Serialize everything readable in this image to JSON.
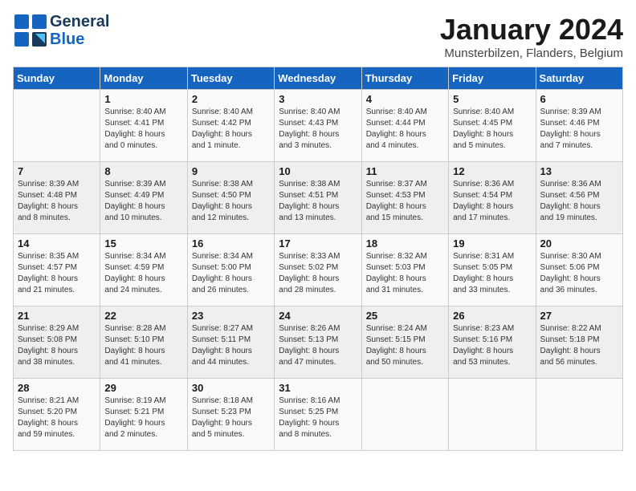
{
  "header": {
    "logo_line1": "General",
    "logo_line2": "Blue",
    "title": "January 2024",
    "subtitle": "Munsterbilzen, Flanders, Belgium"
  },
  "days_of_week": [
    "Sunday",
    "Monday",
    "Tuesday",
    "Wednesday",
    "Thursday",
    "Friday",
    "Saturday"
  ],
  "weeks": [
    [
      {
        "day": "",
        "info": ""
      },
      {
        "day": "1",
        "info": "Sunrise: 8:40 AM\nSunset: 4:41 PM\nDaylight: 8 hours\nand 0 minutes."
      },
      {
        "day": "2",
        "info": "Sunrise: 8:40 AM\nSunset: 4:42 PM\nDaylight: 8 hours\nand 1 minute."
      },
      {
        "day": "3",
        "info": "Sunrise: 8:40 AM\nSunset: 4:43 PM\nDaylight: 8 hours\nand 3 minutes."
      },
      {
        "day": "4",
        "info": "Sunrise: 8:40 AM\nSunset: 4:44 PM\nDaylight: 8 hours\nand 4 minutes."
      },
      {
        "day": "5",
        "info": "Sunrise: 8:40 AM\nSunset: 4:45 PM\nDaylight: 8 hours\nand 5 minutes."
      },
      {
        "day": "6",
        "info": "Sunrise: 8:39 AM\nSunset: 4:46 PM\nDaylight: 8 hours\nand 7 minutes."
      }
    ],
    [
      {
        "day": "7",
        "info": "Sunrise: 8:39 AM\nSunset: 4:48 PM\nDaylight: 8 hours\nand 8 minutes."
      },
      {
        "day": "8",
        "info": "Sunrise: 8:39 AM\nSunset: 4:49 PM\nDaylight: 8 hours\nand 10 minutes."
      },
      {
        "day": "9",
        "info": "Sunrise: 8:38 AM\nSunset: 4:50 PM\nDaylight: 8 hours\nand 12 minutes."
      },
      {
        "day": "10",
        "info": "Sunrise: 8:38 AM\nSunset: 4:51 PM\nDaylight: 8 hours\nand 13 minutes."
      },
      {
        "day": "11",
        "info": "Sunrise: 8:37 AM\nSunset: 4:53 PM\nDaylight: 8 hours\nand 15 minutes."
      },
      {
        "day": "12",
        "info": "Sunrise: 8:36 AM\nSunset: 4:54 PM\nDaylight: 8 hours\nand 17 minutes."
      },
      {
        "day": "13",
        "info": "Sunrise: 8:36 AM\nSunset: 4:56 PM\nDaylight: 8 hours\nand 19 minutes."
      }
    ],
    [
      {
        "day": "14",
        "info": "Sunrise: 8:35 AM\nSunset: 4:57 PM\nDaylight: 8 hours\nand 21 minutes."
      },
      {
        "day": "15",
        "info": "Sunrise: 8:34 AM\nSunset: 4:59 PM\nDaylight: 8 hours\nand 24 minutes."
      },
      {
        "day": "16",
        "info": "Sunrise: 8:34 AM\nSunset: 5:00 PM\nDaylight: 8 hours\nand 26 minutes."
      },
      {
        "day": "17",
        "info": "Sunrise: 8:33 AM\nSunset: 5:02 PM\nDaylight: 8 hours\nand 28 minutes."
      },
      {
        "day": "18",
        "info": "Sunrise: 8:32 AM\nSunset: 5:03 PM\nDaylight: 8 hours\nand 31 minutes."
      },
      {
        "day": "19",
        "info": "Sunrise: 8:31 AM\nSunset: 5:05 PM\nDaylight: 8 hours\nand 33 minutes."
      },
      {
        "day": "20",
        "info": "Sunrise: 8:30 AM\nSunset: 5:06 PM\nDaylight: 8 hours\nand 36 minutes."
      }
    ],
    [
      {
        "day": "21",
        "info": "Sunrise: 8:29 AM\nSunset: 5:08 PM\nDaylight: 8 hours\nand 38 minutes."
      },
      {
        "day": "22",
        "info": "Sunrise: 8:28 AM\nSunset: 5:10 PM\nDaylight: 8 hours\nand 41 minutes."
      },
      {
        "day": "23",
        "info": "Sunrise: 8:27 AM\nSunset: 5:11 PM\nDaylight: 8 hours\nand 44 minutes."
      },
      {
        "day": "24",
        "info": "Sunrise: 8:26 AM\nSunset: 5:13 PM\nDaylight: 8 hours\nand 47 minutes."
      },
      {
        "day": "25",
        "info": "Sunrise: 8:24 AM\nSunset: 5:15 PM\nDaylight: 8 hours\nand 50 minutes."
      },
      {
        "day": "26",
        "info": "Sunrise: 8:23 AM\nSunset: 5:16 PM\nDaylight: 8 hours\nand 53 minutes."
      },
      {
        "day": "27",
        "info": "Sunrise: 8:22 AM\nSunset: 5:18 PM\nDaylight: 8 hours\nand 56 minutes."
      }
    ],
    [
      {
        "day": "28",
        "info": "Sunrise: 8:21 AM\nSunset: 5:20 PM\nDaylight: 8 hours\nand 59 minutes."
      },
      {
        "day": "29",
        "info": "Sunrise: 8:19 AM\nSunset: 5:21 PM\nDaylight: 9 hours\nand 2 minutes."
      },
      {
        "day": "30",
        "info": "Sunrise: 8:18 AM\nSunset: 5:23 PM\nDaylight: 9 hours\nand 5 minutes."
      },
      {
        "day": "31",
        "info": "Sunrise: 8:16 AM\nSunset: 5:25 PM\nDaylight: 9 hours\nand 8 minutes."
      },
      {
        "day": "",
        "info": ""
      },
      {
        "day": "",
        "info": ""
      },
      {
        "day": "",
        "info": ""
      }
    ]
  ]
}
